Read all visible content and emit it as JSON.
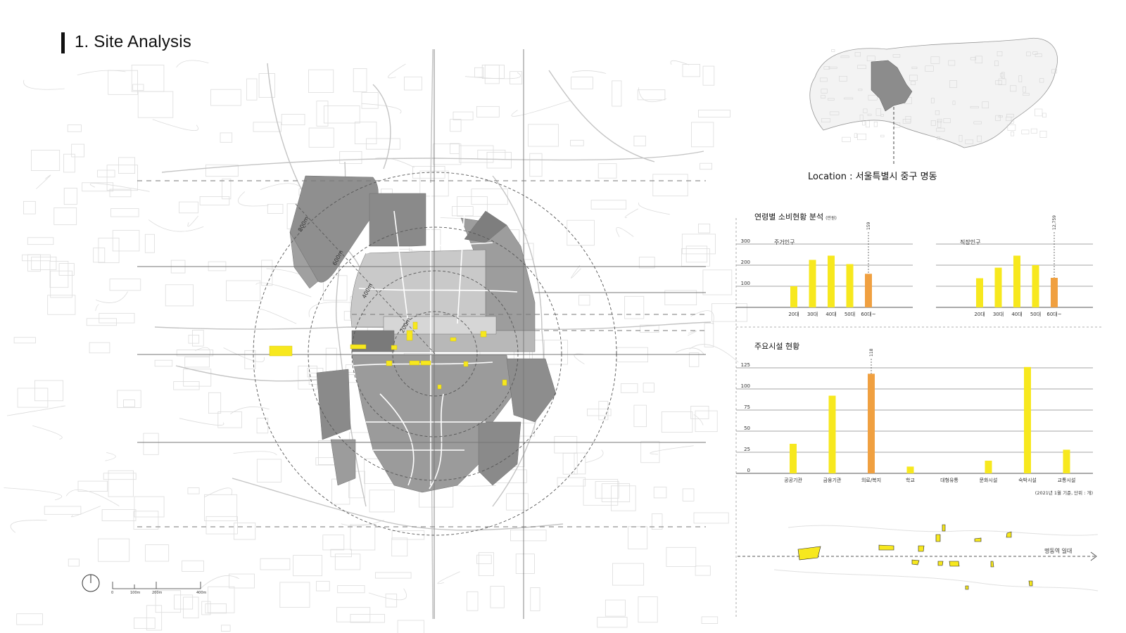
{
  "title": "1. Site Analysis",
  "location_label": "Location : 서울특별시 중구 명동",
  "map": {
    "radius_labels": [
      "800m",
      "600m",
      "400m",
      "200m"
    ],
    "scale_ticks": [
      "0",
      "100m",
      "200m",
      "400m"
    ],
    "highlight_color": "#f7e81e",
    "block_color": "#9a9a9a",
    "north_arrow_icon": "north-arrow-icon"
  },
  "chart_data": [
    {
      "type": "bar",
      "title": "연령별 소비현황 분석",
      "unit_note": "(만원)",
      "subtitle": "주거인구",
      "categories": [
        "20대",
        "30대",
        "40대",
        "50대",
        "60대~"
      ],
      "values": [
        100,
        225,
        245,
        205,
        159
      ],
      "highlight_index": 4,
      "highlight_label": "159",
      "yticks": [
        "300",
        "200",
        "100"
      ],
      "ylim": [
        0,
        300
      ]
    },
    {
      "type": "bar",
      "subtitle": "직장인구",
      "categories": [
        "20대",
        "30대",
        "40대",
        "50대",
        "60대~"
      ],
      "values": [
        138,
        188,
        245,
        200,
        140
      ],
      "highlight_index": 4,
      "highlight_label": "12,759",
      "ylim": [
        0,
        300
      ]
    },
    {
      "type": "bar",
      "title": "주요시설 현황",
      "categories": [
        "공공기관",
        "금융기관",
        "의료/복지",
        "학교",
        "대형유통",
        "문화시설",
        "숙박시설",
        "교통시설"
      ],
      "values": [
        35,
        92,
        118,
        8,
        0,
        15,
        126,
        28
      ],
      "highlight_index": 2,
      "highlight_label": "118",
      "yticks": [
        "125",
        "100",
        "75",
        "50",
        "25",
        "0"
      ],
      "ylim": [
        0,
        125
      ],
      "footnote": "(2021년 1월 기준, 단위 : 개)"
    }
  ],
  "strip": {
    "label": "명동역 일대"
  },
  "colors": {
    "bar": "#f7e81e",
    "highlight": "#f0a040"
  }
}
